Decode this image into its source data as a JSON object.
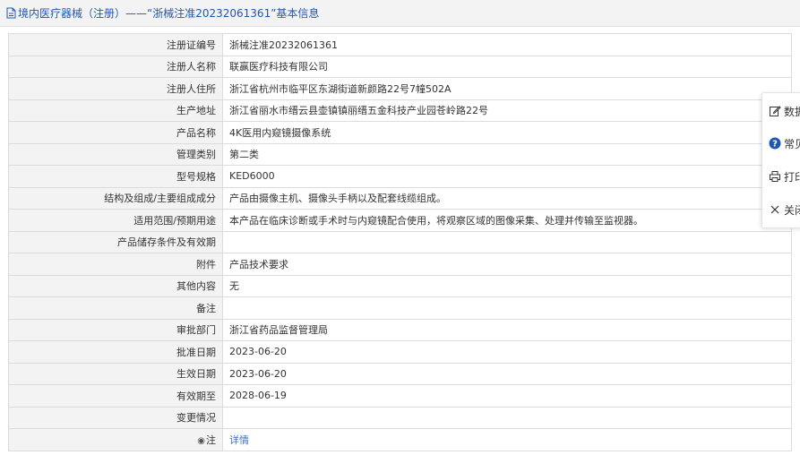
{
  "header": {
    "title": "境内医疗器械（注册）——“浙械注准20232061361”基本信息"
  },
  "rows": [
    {
      "label": "注册证编号",
      "value": "浙械注准20232061361"
    },
    {
      "label": "注册人名称",
      "value": "联赢医疗科技有限公司"
    },
    {
      "label": "注册人住所",
      "value": "浙江省杭州市临平区东湖街道新颜路22号7幢502A"
    },
    {
      "label": "生产地址",
      "value": "浙江省丽水市缙云县壶镇镇丽缙五金科技产业园苍岭路22号"
    },
    {
      "label": "产品名称",
      "value": "4K医用内窥镜摄像系统"
    },
    {
      "label": "管理类别",
      "value": "第二类"
    },
    {
      "label": "型号规格",
      "value": "KED6000"
    },
    {
      "label": "结构及组成/主要组成成分",
      "value": "产品由摄像主机、摄像头手柄以及配套线缆组成。"
    },
    {
      "label": "适用范围/预期用途",
      "value": "本产品在临床诊断或手术时与内窥镜配合使用，将观察区域的图像采集、处理并传输至监视器。"
    },
    {
      "label": "产品储存条件及有效期",
      "value": ""
    },
    {
      "label": "附件",
      "value": "产品技术要求"
    },
    {
      "label": "其他内容",
      "value": "无"
    },
    {
      "label": "备注",
      "value": ""
    },
    {
      "label": "审批部门",
      "value": "浙江省药品监督管理局"
    },
    {
      "label": "批准日期",
      "value": "2023-06-20"
    },
    {
      "label": "生效日期",
      "value": "2023-06-20"
    },
    {
      "label": "有效期至",
      "value": "2028-06-19"
    },
    {
      "label": "变更情况",
      "value": ""
    }
  ],
  "note_row": {
    "label": "注",
    "link_text": "详情"
  },
  "float_menu": {
    "items": [
      {
        "label": "数据",
        "icon": "edit-icon"
      },
      {
        "label": "常见",
        "icon": "help-icon"
      },
      {
        "label": "打印",
        "icon": "print-icon"
      },
      {
        "label": "关闭",
        "icon": "close-icon"
      }
    ]
  },
  "colors": {
    "title_blue": "#1f58b4",
    "link_blue": "#3b6fc1",
    "label_bg": "#f3f3f3",
    "border": "#dcdcdc"
  }
}
